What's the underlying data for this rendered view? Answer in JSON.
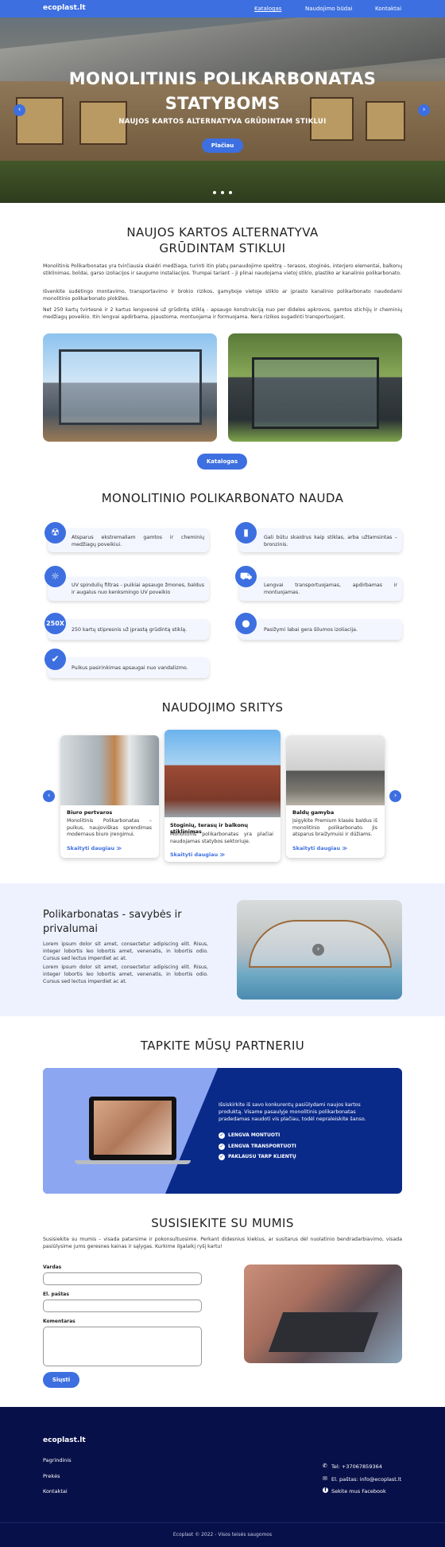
{
  "nav": {
    "logo": "ecoplast.lt",
    "links": [
      "Katalogas",
      "Naudojimo būdai",
      "Kontaktai"
    ]
  },
  "hero": {
    "title": "MONOLITINIS POLIKARBONATAS STATYBOMS",
    "subtitle": "NAUJOS KARTOS ALTERNATYVA GRŪDINTAM STIKLUI",
    "button": "Plačiau"
  },
  "intro": {
    "title": "NAUJOS KARTOS ALTERNATYVA GRŪDINTAM STIKLUI",
    "paragraphs": [
      "Monolitinis Polikarbonatas yra tvirčiausia skaidri medžiaga, turinti itin platų panaudojimo spektrą – terasos, stoginės, interjero elementai, balkonų stiklinimas, boldai, garso izoliacijos ir saugumo instaliacijos. Trumpai tariant – ji plinai naudojama vietoj stiklo, plastiko ar kanalinio polikarbonato.",
      "Išvenkite sudėtingo montavimo, transportavimo ir brokio rizikos, gamyboje vietoje stiklo ar įprasto kanalinio polikarbonato naudodami monolitinio polikarbonato plokštes.",
      "Net 250 kartų tvirtesnė ir 2 kartus lengvesnė už grūdintą stiklą - apsaugo konstrukciją nuo per dideles apkrovos, gamtos stichijų ir cheminių medžiagų poveikio. Itin lengvai apdirbama, pjaustoma, montuojama ir formuojama. Nera rizikos sugadinti transportuojant."
    ],
    "button": "Katalogas"
  },
  "benefits": {
    "title": "MONOLITINIO POLIKARBONATO NAUDA",
    "items": [
      {
        "icon": "radiation-icon",
        "glyph": "☢",
        "text": "Atsparus ekstremaliam gamtos ir cheminių medžiagų poveikiui."
      },
      {
        "icon": "glass-icon",
        "glyph": "▮",
        "text": "Gali būtu skaidrus kaip stiklas, arba užtamsintas – bronzinis."
      },
      {
        "icon": "uv-sun-icon",
        "glyph": "☼",
        "text": "UV spindulių filtras - puikiai apsaugo žmones, baldus ir augalus nuo kenksmingo UV poveikio"
      },
      {
        "icon": "truck-icon",
        "glyph": "⛟",
        "text": "Lengvai transportuojamas, apdirbamas ir montuojamas."
      },
      {
        "icon": "250x-icon",
        "glyph": "250X",
        "text": "250 kartų stipresnis už įprastą grūdintą stiklą."
      },
      {
        "icon": "drop-icon",
        "glyph": "●",
        "text": "Pasižymi labai gera šilumos izoliacija."
      },
      {
        "icon": "shield-icon",
        "glyph": "✔",
        "text": "Puikus pasirinkimas apsaugai nuo vandalizmo."
      }
    ]
  },
  "usage": {
    "title": "NAUDOJIMO SRITYS",
    "cards": [
      {
        "title": "Biuro pertvaros",
        "text": "Monolitinis Polikarbonatas – puikus, naujoviškas sprendimas modernaus biuro įrengimui.",
        "link": "Skaityti daugiau"
      },
      {
        "title": "Stoginių, terasų ir balkonų stiklinimas",
        "text": "Monolitinis polikarbonatas yra plačiai naudojamas statybos sektoriuje.",
        "link": "Skaityti daugiau"
      },
      {
        "title": "Baldų gamyba",
        "text": "Įsigykite Premium klasės baldus iš monolitinio polikarbonato. Jis atsparus braižymuisi ir dūžiams.",
        "link": "Skaityti daugiau"
      }
    ]
  },
  "properties": {
    "title": "Polikarbonatas - savybės ir privalumai",
    "paragraphs": [
      "Lorem ipsum dolor sit amet, consectetur adipiscing elit. Risus, integer lobortis leo lobortis amet, venenatis, in lobortis odio. Cursus sed lectus imperdiet ac at.",
      "Lorem ipsum dolor sit amet, consectetur adipiscing elit. Risus, integer lobortis leo lobortis amet, venenatis, in lobortis odio. Cursus sed lectus imperdiet ac at."
    ]
  },
  "partner": {
    "title": "TAPKITE MŪSŲ PARTNERIU",
    "text": "Išsiskirkite iš savo konkurentų pasiūlydami naujos kartos produktą. Visame pasaulyje monolitinis polikarbonatas pradedamas naudoti vis plačiau, todėl nepraleiskite šanso.",
    "points": [
      "LENGVA MONTUOTI",
      "LENGVA TRANSPORTUOTI",
      "PAKLAUSU TARP KLIENTŲ"
    ]
  },
  "contact": {
    "title": "SUSISIEKITE SU MUMIS",
    "intro": "Susisiekite su mumis – visada patarsime ir pokonsultuosime. Perkant didesnius kiekius, ar susitarus dėl nuolatinio bendradarbiavimo, visada pasiūlysime jums geresnes kainas ir sąlygas. Kurkime ilgalaikį ryšį kartu!",
    "labels": {
      "name": "Vardas",
      "email": "El. paštas",
      "comment": "Komentaras"
    },
    "button": "Siųsti"
  },
  "footer": {
    "logo": "ecoplast.lt",
    "links": [
      "Pagrindinis",
      "Prekės",
      "Kontaktai"
    ],
    "contacts": [
      "Tel: +37067859364",
      "El. paštas: info@ecoplast.lt",
      "Sekite mus Facebook"
    ],
    "copyright": "Ecoplast © 2022 - Visos teisės saugomos"
  },
  "colors": {
    "accent": "#3d6fe0",
    "footer_bg": "#081049",
    "partner_bg": "#0a2a8a",
    "properties_bg": "#eef2ff"
  }
}
